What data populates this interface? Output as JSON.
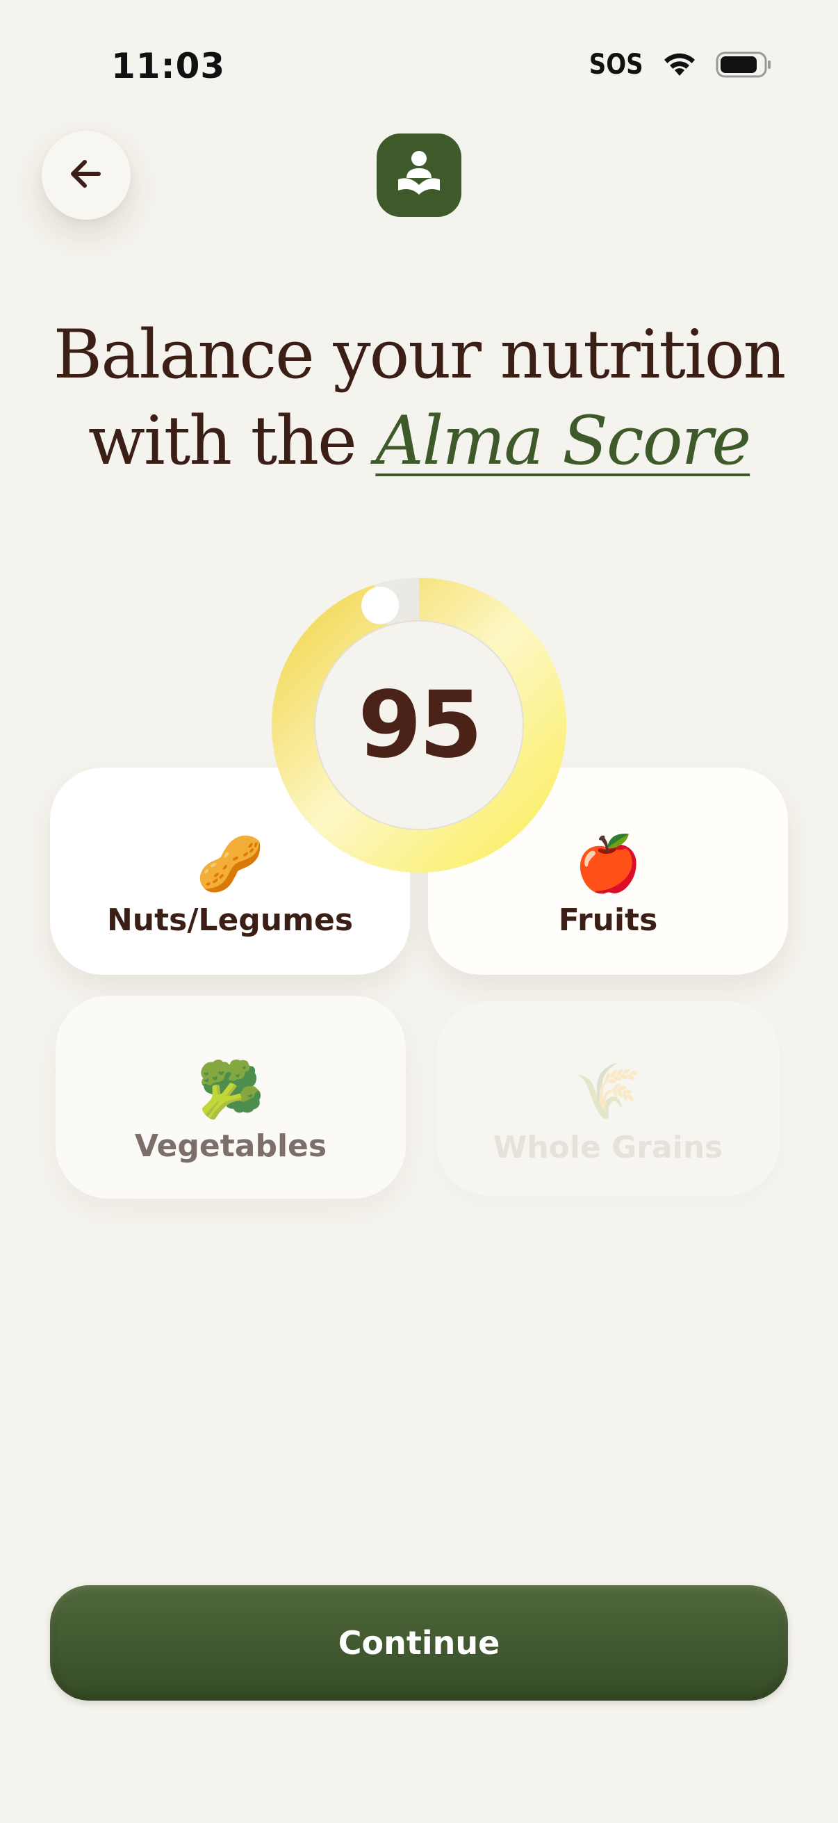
{
  "status_bar": {
    "time": "11:03",
    "sos": "SOS"
  },
  "header": {
    "back_icon": "arrow-left-icon",
    "logo_icon": "person-reading-book-icon"
  },
  "headline": {
    "line1": "Balance your nutrition",
    "line2_prefix": "with the ",
    "accent": "Alma Score"
  },
  "score": {
    "value": "95",
    "progress": 0.95
  },
  "categories": [
    {
      "emoji": "🥜",
      "label": "Nuts/Legumes"
    },
    {
      "emoji": "🍎",
      "label": "Fruits"
    },
    {
      "emoji": "🥦",
      "label": "Vegetables"
    },
    {
      "emoji": "🌾",
      "label": "Whole Grains"
    }
  ],
  "cta": {
    "label": "Continue"
  },
  "colors": {
    "background": "#f5f3ed",
    "brand_green": "#3e5a2b",
    "text_brown": "#3b1f17",
    "ring_yellow": "#f3dd4c"
  }
}
